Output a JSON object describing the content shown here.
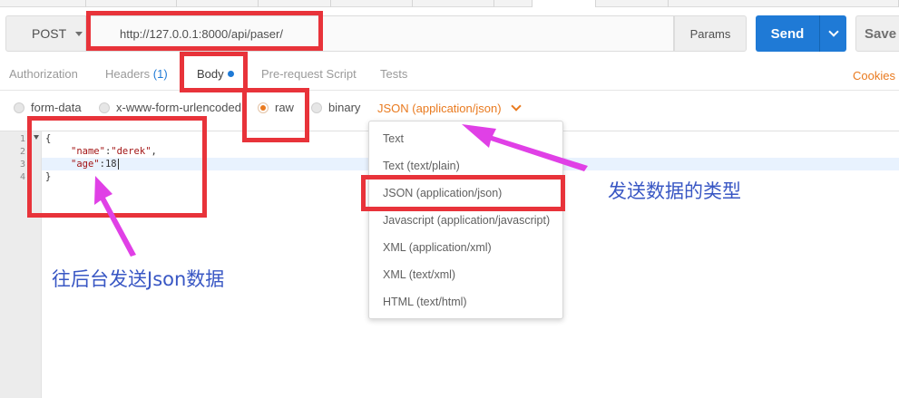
{
  "request": {
    "method": "POST",
    "url": "http://127.0.0.1:8000/api/paser/",
    "params_label": "Params",
    "send_label": "Send",
    "save_label": "Save"
  },
  "tabs": [
    {
      "label": "Authorization"
    },
    {
      "label": "Headers",
      "count": "(1)"
    },
    {
      "label": "Body"
    },
    {
      "label": "Pre-request Script"
    },
    {
      "label": "Tests"
    }
  ],
  "cookies_label": "Cookies",
  "body_types": [
    {
      "label": "form-data",
      "selected": false
    },
    {
      "label": "x-www-form-urlencoded",
      "selected": false
    },
    {
      "label": "raw",
      "selected": true
    },
    {
      "label": "binary",
      "selected": false
    }
  ],
  "content_type": "JSON (application/json)",
  "editor": {
    "line_numbers": [
      "1",
      "2",
      "3",
      "4"
    ],
    "lines": {
      "l1": "{",
      "l2_key": "\"name\"",
      "l2_sep": ":",
      "l2_val": "\"derek\"",
      "l2_end": ",",
      "l3_key": "\"age\"",
      "l3_sep": ":",
      "l3_val": "18",
      "l4": "}"
    }
  },
  "dropdown_items": [
    "Text",
    "Text (text/plain)",
    "JSON (application/json)",
    "Javascript (application/javascript)",
    "XML (application/xml)",
    "XML (text/xml)",
    "HTML (text/html)"
  ],
  "annotations": {
    "send_type": "发送数据的类型",
    "send_json": "往后台发送Json数据"
  },
  "colors": {
    "accent_blue": "#1f7ad6",
    "accent_orange": "#e97a1f",
    "annotation_red": "#e8333a",
    "annotation_arrow": "#e040e6",
    "annotation_text": "#3957c4"
  }
}
